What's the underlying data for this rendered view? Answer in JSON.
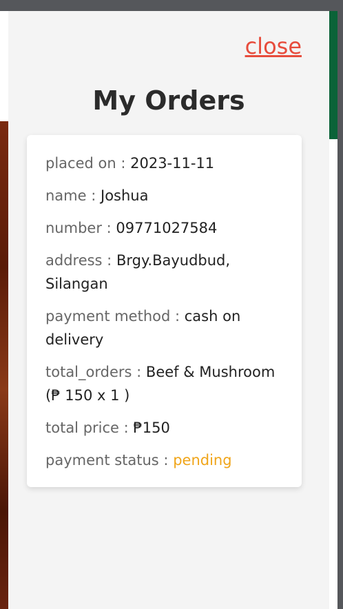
{
  "header": {
    "close_label": "close",
    "title": "My Orders"
  },
  "order": {
    "placed_on": {
      "label": "placed on :",
      "value": "2023-11-11"
    },
    "name": {
      "label": "name :",
      "value": "Joshua"
    },
    "number": {
      "label": "number :",
      "value": "09771027584"
    },
    "address": {
      "label": "address :",
      "value": "Brgy.Bayudbud, Silangan"
    },
    "payment_method": {
      "label": "payment method :",
      "value": "cash on delivery"
    },
    "total_orders": {
      "label": "total_orders :",
      "value": "Beef & Mushroom (₱ 150 x 1 )"
    },
    "total_price": {
      "label": "total price :",
      "value": "₱150"
    },
    "payment_status": {
      "label": "payment status :",
      "value": "pending"
    }
  },
  "colors": {
    "close_link": "#e74c3c",
    "status_pending": "#f0a51a",
    "panel_bg": "#f4f4f4",
    "accent_green": "#0a6338"
  }
}
